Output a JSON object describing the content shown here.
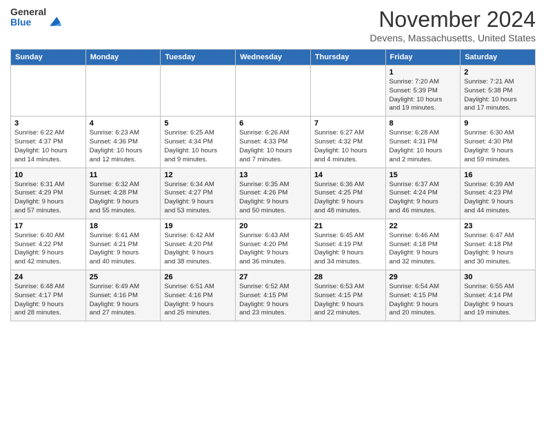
{
  "header": {
    "logo_general": "General",
    "logo_blue": "Blue",
    "month_title": "November 2024",
    "location": "Devens, Massachusetts, United States"
  },
  "days_of_week": [
    "Sunday",
    "Monday",
    "Tuesday",
    "Wednesday",
    "Thursday",
    "Friday",
    "Saturday"
  ],
  "weeks": [
    [
      {
        "day": "",
        "info": ""
      },
      {
        "day": "",
        "info": ""
      },
      {
        "day": "",
        "info": ""
      },
      {
        "day": "",
        "info": ""
      },
      {
        "day": "",
        "info": ""
      },
      {
        "day": "1",
        "info": "Sunrise: 7:20 AM\nSunset: 5:39 PM\nDaylight: 10 hours\nand 19 minutes."
      },
      {
        "day": "2",
        "info": "Sunrise: 7:21 AM\nSunset: 5:38 PM\nDaylight: 10 hours\nand 17 minutes."
      }
    ],
    [
      {
        "day": "3",
        "info": "Sunrise: 6:22 AM\nSunset: 4:37 PM\nDaylight: 10 hours\nand 14 minutes."
      },
      {
        "day": "4",
        "info": "Sunrise: 6:23 AM\nSunset: 4:36 PM\nDaylight: 10 hours\nand 12 minutes."
      },
      {
        "day": "5",
        "info": "Sunrise: 6:25 AM\nSunset: 4:34 PM\nDaylight: 10 hours\nand 9 minutes."
      },
      {
        "day": "6",
        "info": "Sunrise: 6:26 AM\nSunset: 4:33 PM\nDaylight: 10 hours\nand 7 minutes."
      },
      {
        "day": "7",
        "info": "Sunrise: 6:27 AM\nSunset: 4:32 PM\nDaylight: 10 hours\nand 4 minutes."
      },
      {
        "day": "8",
        "info": "Sunrise: 6:28 AM\nSunset: 4:31 PM\nDaylight: 10 hours\nand 2 minutes."
      },
      {
        "day": "9",
        "info": "Sunrise: 6:30 AM\nSunset: 4:30 PM\nDaylight: 9 hours\nand 59 minutes."
      }
    ],
    [
      {
        "day": "10",
        "info": "Sunrise: 6:31 AM\nSunset: 4:29 PM\nDaylight: 9 hours\nand 57 minutes."
      },
      {
        "day": "11",
        "info": "Sunrise: 6:32 AM\nSunset: 4:28 PM\nDaylight: 9 hours\nand 55 minutes."
      },
      {
        "day": "12",
        "info": "Sunrise: 6:34 AM\nSunset: 4:27 PM\nDaylight: 9 hours\nand 53 minutes."
      },
      {
        "day": "13",
        "info": "Sunrise: 6:35 AM\nSunset: 4:26 PM\nDaylight: 9 hours\nand 50 minutes."
      },
      {
        "day": "14",
        "info": "Sunrise: 6:36 AM\nSunset: 4:25 PM\nDaylight: 9 hours\nand 48 minutes."
      },
      {
        "day": "15",
        "info": "Sunrise: 6:37 AM\nSunset: 4:24 PM\nDaylight: 9 hours\nand 46 minutes."
      },
      {
        "day": "16",
        "info": "Sunrise: 6:39 AM\nSunset: 4:23 PM\nDaylight: 9 hours\nand 44 minutes."
      }
    ],
    [
      {
        "day": "17",
        "info": "Sunrise: 6:40 AM\nSunset: 4:22 PM\nDaylight: 9 hours\nand 42 minutes."
      },
      {
        "day": "18",
        "info": "Sunrise: 6:41 AM\nSunset: 4:21 PM\nDaylight: 9 hours\nand 40 minutes."
      },
      {
        "day": "19",
        "info": "Sunrise: 6:42 AM\nSunset: 4:20 PM\nDaylight: 9 hours\nand 38 minutes."
      },
      {
        "day": "20",
        "info": "Sunrise: 6:43 AM\nSunset: 4:20 PM\nDaylight: 9 hours\nand 36 minutes."
      },
      {
        "day": "21",
        "info": "Sunrise: 6:45 AM\nSunset: 4:19 PM\nDaylight: 9 hours\nand 34 minutes."
      },
      {
        "day": "22",
        "info": "Sunrise: 6:46 AM\nSunset: 4:18 PM\nDaylight: 9 hours\nand 32 minutes."
      },
      {
        "day": "23",
        "info": "Sunrise: 6:47 AM\nSunset: 4:18 PM\nDaylight: 9 hours\nand 30 minutes."
      }
    ],
    [
      {
        "day": "24",
        "info": "Sunrise: 6:48 AM\nSunset: 4:17 PM\nDaylight: 9 hours\nand 28 minutes."
      },
      {
        "day": "25",
        "info": "Sunrise: 6:49 AM\nSunset: 4:16 PM\nDaylight: 9 hours\nand 27 minutes."
      },
      {
        "day": "26",
        "info": "Sunrise: 6:51 AM\nSunset: 4:16 PM\nDaylight: 9 hours\nand 25 minutes."
      },
      {
        "day": "27",
        "info": "Sunrise: 6:52 AM\nSunset: 4:15 PM\nDaylight: 9 hours\nand 23 minutes."
      },
      {
        "day": "28",
        "info": "Sunrise: 6:53 AM\nSunset: 4:15 PM\nDaylight: 9 hours\nand 22 minutes."
      },
      {
        "day": "29",
        "info": "Sunrise: 6:54 AM\nSunset: 4:15 PM\nDaylight: 9 hours\nand 20 minutes."
      },
      {
        "day": "30",
        "info": "Sunrise: 6:55 AM\nSunset: 4:14 PM\nDaylight: 9 hours\nand 19 minutes."
      }
    ]
  ]
}
